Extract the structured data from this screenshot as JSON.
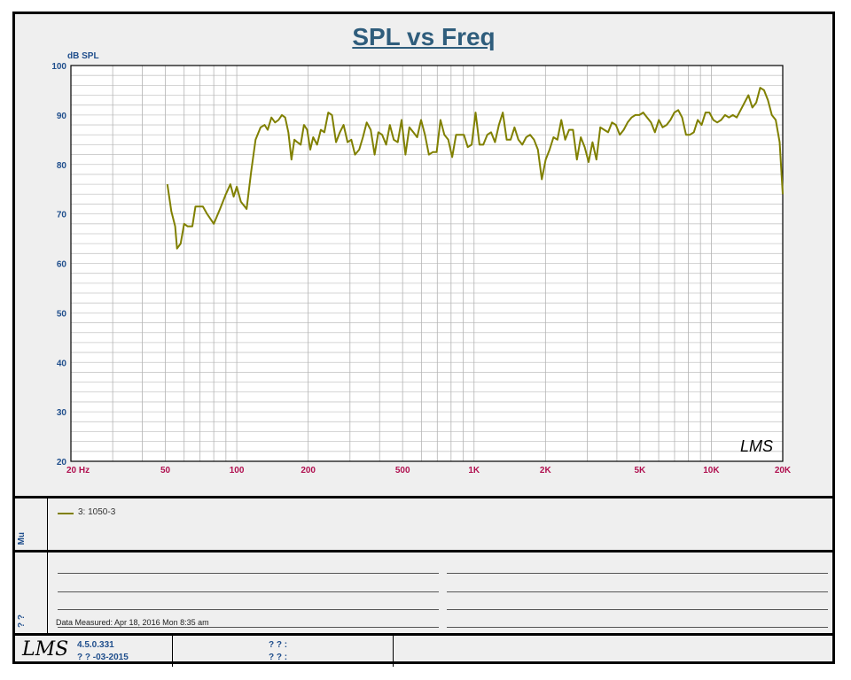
{
  "chart_data": {
    "type": "line",
    "title": "SPL vs Freq",
    "ylabel": "dB SPL",
    "xlabel": "",
    "x_scale": "log",
    "xlim": [
      20,
      20000
    ],
    "ylim": [
      20,
      100
    ],
    "grid": true,
    "y_ticks": [
      {
        "value": 100,
        "label": "100"
      },
      {
        "value": 90,
        "label": "90"
      },
      {
        "value": 80,
        "label": "80"
      },
      {
        "value": 70,
        "label": "70"
      },
      {
        "value": 60,
        "label": "60"
      },
      {
        "value": 50,
        "label": "50"
      },
      {
        "value": 40,
        "label": "40"
      },
      {
        "value": 30,
        "label": "30"
      },
      {
        "value": 20,
        "label": "20"
      }
    ],
    "x_ticks": [
      {
        "value": 20,
        "label": "20  Hz"
      },
      {
        "value": 50,
        "label": "50"
      },
      {
        "value": 100,
        "label": "100"
      },
      {
        "value": 200,
        "label": "200"
      },
      {
        "value": 500,
        "label": "500"
      },
      {
        "value": 1000,
        "label": "1K"
      },
      {
        "value": 2000,
        "label": "2K"
      },
      {
        "value": 5000,
        "label": "5K"
      },
      {
        "value": 10000,
        "label": "10K"
      },
      {
        "value": 20000,
        "label": "20K"
      }
    ],
    "series": [
      {
        "name": "3: 1050-3",
        "color": "#808000",
        "points": [
          [
            51,
            76
          ],
          [
            53,
            70.5
          ],
          [
            55,
            67.5
          ],
          [
            56,
            63
          ],
          [
            58,
            64
          ],
          [
            60,
            68
          ],
          [
            62,
            67.5
          ],
          [
            65,
            67.5
          ],
          [
            67,
            71.5
          ],
          [
            72,
            71.5
          ],
          [
            75,
            70
          ],
          [
            80,
            68
          ],
          [
            85,
            71
          ],
          [
            90,
            74
          ],
          [
            94,
            76
          ],
          [
            97,
            73.5
          ],
          [
            100,
            75.5
          ],
          [
            104,
            72.5
          ],
          [
            110,
            71
          ],
          [
            115,
            78.5
          ],
          [
            120,
            85
          ],
          [
            126,
            87.5
          ],
          [
            131,
            88
          ],
          [
            135,
            87
          ],
          [
            140,
            89.5
          ],
          [
            145,
            88.5
          ],
          [
            150,
            89
          ],
          [
            155,
            90
          ],
          [
            160,
            89.5
          ],
          [
            165,
            86.5
          ],
          [
            170,
            81
          ],
          [
            175,
            85
          ],
          [
            180,
            84.5
          ],
          [
            186,
            84
          ],
          [
            192,
            88
          ],
          [
            198,
            87
          ],
          [
            204,
            83
          ],
          [
            210,
            85.5
          ],
          [
            218,
            84
          ],
          [
            226,
            87
          ],
          [
            234,
            86.5
          ],
          [
            243,
            90.5
          ],
          [
            252,
            90
          ],
          [
            262,
            84.5
          ],
          [
            272,
            86.5
          ],
          [
            282,
            88
          ],
          [
            293,
            84.5
          ],
          [
            304,
            85
          ],
          [
            315,
            82
          ],
          [
            328,
            83
          ],
          [
            340,
            85.5
          ],
          [
            353,
            88.5
          ],
          [
            367,
            87
          ],
          [
            381,
            82
          ],
          [
            395,
            86.5
          ],
          [
            410,
            86
          ],
          [
            426,
            84
          ],
          [
            442,
            88
          ],
          [
            459,
            85
          ],
          [
            477,
            84.5
          ],
          [
            495,
            89
          ],
          [
            514,
            82
          ],
          [
            534,
            87.5
          ],
          [
            555,
            86.5
          ],
          [
            576,
            85.5
          ],
          [
            598,
            89
          ],
          [
            621,
            86
          ],
          [
            645,
            82
          ],
          [
            670,
            82.5
          ],
          [
            696,
            82.5
          ],
          [
            722,
            89
          ],
          [
            750,
            86
          ],
          [
            779,
            85
          ],
          [
            809,
            81.5
          ],
          [
            840,
            86
          ],
          [
            872,
            86
          ],
          [
            906,
            86
          ],
          [
            941,
            83.5
          ],
          [
            977,
            84
          ],
          [
            1015,
            90.5
          ],
          [
            1054,
            84
          ],
          [
            1094,
            84
          ],
          [
            1137,
            86
          ],
          [
            1180,
            86.5
          ],
          [
            1226,
            84.5
          ],
          [
            1273,
            88
          ],
          [
            1322,
            90.5
          ],
          [
            1373,
            85
          ],
          [
            1426,
            85
          ],
          [
            1481,
            87.5
          ],
          [
            1538,
            85
          ],
          [
            1597,
            84
          ],
          [
            1659,
            85.5
          ],
          [
            1723,
            86
          ],
          [
            1789,
            85
          ],
          [
            1858,
            83
          ],
          [
            1930,
            77
          ],
          [
            2004,
            81
          ],
          [
            2082,
            83
          ],
          [
            2162,
            85.5
          ],
          [
            2245,
            85
          ],
          [
            2332,
            89
          ],
          [
            2422,
            85
          ],
          [
            2515,
            87
          ],
          [
            2612,
            87
          ],
          [
            2713,
            81
          ],
          [
            2818,
            85.5
          ],
          [
            2927,
            83.5
          ],
          [
            3039,
            80.5
          ],
          [
            3157,
            84.5
          ],
          [
            3278,
            81
          ],
          [
            3405,
            87.5
          ],
          [
            3536,
            87
          ],
          [
            3673,
            86.5
          ],
          [
            3814,
            88.5
          ],
          [
            3961,
            88
          ],
          [
            4114,
            86
          ],
          [
            4273,
            87
          ],
          [
            4437,
            88.5
          ],
          [
            4608,
            89.5
          ],
          [
            4786,
            90
          ],
          [
            4971,
            90
          ],
          [
            5162,
            90.5
          ],
          [
            5361,
            89.5
          ],
          [
            5568,
            88.5
          ],
          [
            5783,
            86.5
          ],
          [
            6006,
            89
          ],
          [
            6237,
            87.5
          ],
          [
            6478,
            88
          ],
          [
            6727,
            89
          ],
          [
            6987,
            90.5
          ],
          [
            7256,
            91
          ],
          [
            7536,
            89.5
          ],
          [
            7826,
            86
          ],
          [
            8128,
            86
          ],
          [
            8442,
            86.5
          ],
          [
            8767,
            89
          ],
          [
            9105,
            88
          ],
          [
            9456,
            90.5
          ],
          [
            9821,
            90.5
          ],
          [
            10199,
            89
          ],
          [
            10592,
            88.5
          ],
          [
            11001,
            89
          ],
          [
            11425,
            90
          ],
          [
            11865,
            89.5
          ],
          [
            12322,
            90
          ],
          [
            12797,
            89.5
          ],
          [
            13291,
            91
          ],
          [
            13803,
            92.5
          ],
          [
            14335,
            94
          ],
          [
            14888,
            91.5
          ],
          [
            15461,
            92.5
          ],
          [
            16057,
            95.5
          ],
          [
            16676,
            95
          ],
          [
            17319,
            93
          ],
          [
            17986,
            90
          ],
          [
            18679,
            89
          ],
          [
            19399,
            84.5
          ],
          [
            20000,
            74
          ]
        ]
      }
    ],
    "watermark": "LMS"
  },
  "legend": {
    "label": "3: 1050-3"
  },
  "notes": {
    "data_measured": "Data Measured: Apr 18, 2016  Mon  8:35 am"
  },
  "footer": {
    "version": "4.5.0.331",
    "build_date": "? ?  -03-2015",
    "field1": "? ? :",
    "field2": "? ? :",
    "logo": "LMS"
  },
  "side_labels": {
    "legend_strip": "Mu",
    "notes_strip": "? ?"
  }
}
